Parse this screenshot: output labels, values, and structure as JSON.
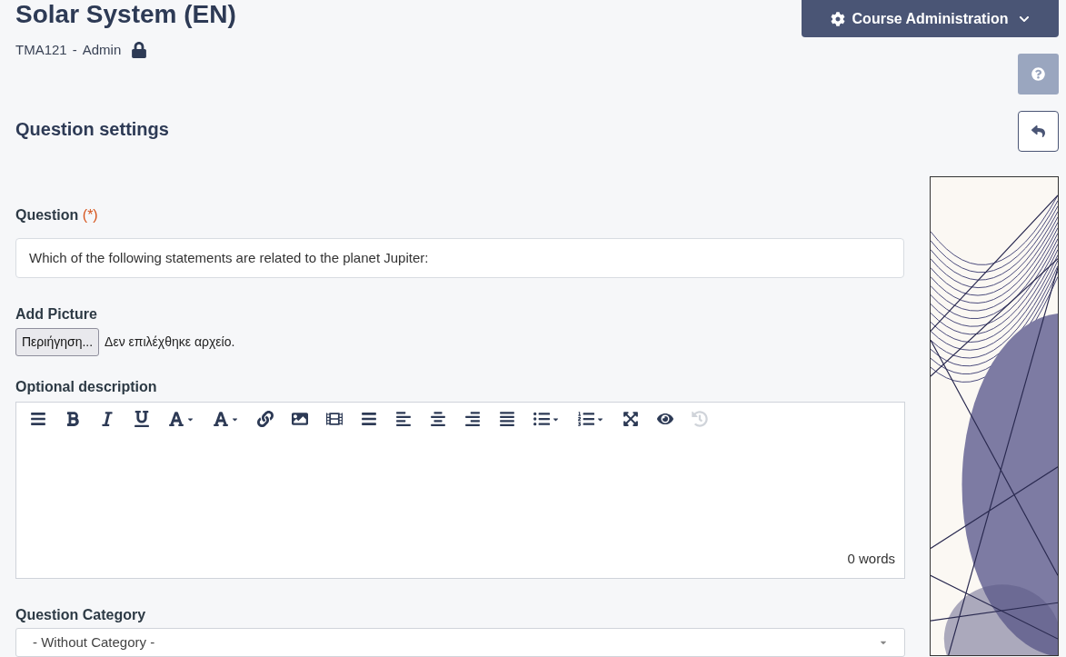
{
  "header": {
    "title": "Solar System (EN)",
    "course_code": "TMA121",
    "separator": "-",
    "role": "Admin",
    "admin_button": "Course Administration"
  },
  "section_title": "Question settings",
  "question": {
    "label": "Question",
    "required_mark": "(*)",
    "value": "Which of the following statements are related to the planet Jupiter:"
  },
  "picture": {
    "label": "Add Picture",
    "browse_button": "Περιήγηση...",
    "status": "Δεν επιλέχθηκε αρχείο."
  },
  "description": {
    "label": "Optional description",
    "word_count": "0 words",
    "toolbar": [
      {
        "kind": "menu",
        "disabled": false
      },
      {
        "kind": "bold",
        "disabled": false
      },
      {
        "kind": "italic",
        "disabled": false
      },
      {
        "kind": "underline",
        "disabled": false
      },
      {
        "kind": "text-color",
        "disabled": false
      },
      {
        "kind": "highlight",
        "disabled": false
      },
      {
        "kind": "link",
        "disabled": false
      },
      {
        "kind": "image",
        "disabled": false
      },
      {
        "kind": "video",
        "disabled": false
      },
      {
        "kind": "paragraph",
        "disabled": false
      },
      {
        "kind": "align-left",
        "disabled": false
      },
      {
        "kind": "align-center",
        "disabled": false
      },
      {
        "kind": "align-right",
        "disabled": false
      },
      {
        "kind": "align-justify",
        "disabled": false
      },
      {
        "kind": "bullet-list",
        "disabled": false
      },
      {
        "kind": "number-list",
        "disabled": false
      },
      {
        "kind": "fullscreen",
        "disabled": false
      },
      {
        "kind": "preview",
        "disabled": false
      },
      {
        "kind": "history",
        "disabled": true
      }
    ]
  },
  "category": {
    "label": "Question Category",
    "value": "- Without Category -"
  }
}
